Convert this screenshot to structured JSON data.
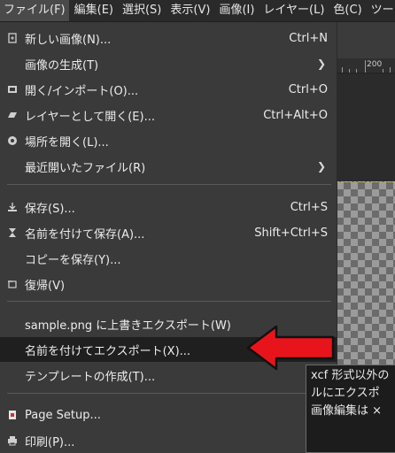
{
  "menubar": {
    "items": [
      {
        "label": "ファイル(F)",
        "active": true
      },
      {
        "label": "編集(E)"
      },
      {
        "label": "選択(S)"
      },
      {
        "label": "表示(V)"
      },
      {
        "label": "画像(I)"
      },
      {
        "label": "レイヤー(L)"
      },
      {
        "label": "色(C)"
      },
      {
        "label": "ツー"
      }
    ]
  },
  "ruler": {
    "label": "200"
  },
  "file_menu": {
    "items": [
      {
        "icon": "new-image-icon",
        "label": "新しい画像(N)...",
        "shortcut": "Ctrl+N"
      },
      {
        "icon": "",
        "label": "画像の生成(T)",
        "submenu": true
      },
      {
        "icon": "open-icon",
        "label": "開く/インポート(O)...",
        "shortcut": "Ctrl+O"
      },
      {
        "icon": "open-as-layers-icon",
        "label": "レイヤーとして開く(E)...",
        "shortcut": "Ctrl+Alt+O"
      },
      {
        "icon": "open-location-icon",
        "label": "場所を開く(L)..."
      },
      {
        "icon": "",
        "label": "最近開いたファイル(R)",
        "submenu": true
      },
      {
        "icon": "save-icon",
        "label": "保存(S)...",
        "shortcut": "Ctrl+S"
      },
      {
        "icon": "save-as-icon",
        "label": "名前を付けて保存(A)...",
        "shortcut": "Shift+Ctrl+S"
      },
      {
        "icon": "",
        "label": "コピーを保存(Y)..."
      },
      {
        "icon": "revert-icon",
        "label": "復帰(V)"
      },
      {
        "icon": "",
        "label": "sample.png に上書きエクスポート(W)"
      },
      {
        "icon": "",
        "label": "名前を付けてエクスポート(X)...",
        "highlighted": true
      },
      {
        "icon": "",
        "label": "テンプレートの作成(T)..."
      },
      {
        "icon": "page-setup-icon",
        "label": "Page Setup..."
      },
      {
        "icon": "print-icon",
        "label": "印刷(P)...",
        "shortcut": "Ct"
      }
    ]
  },
  "tooltip": {
    "lines": [
      "xcf 形式以外の",
      "ルにエクスポ",
      "画像編集は ×"
    ]
  },
  "colors": {
    "arrow": "#e8141c",
    "highlight": "#1f1f1f"
  }
}
